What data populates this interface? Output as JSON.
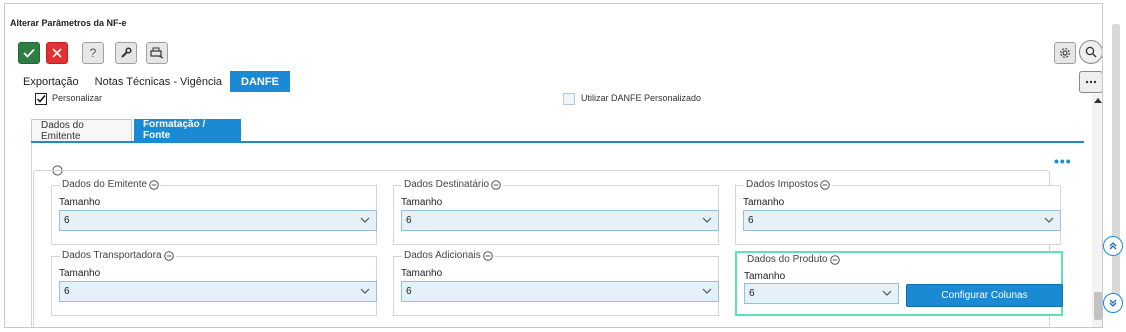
{
  "window": {
    "title": "Alterar Parâmetros da NF-e"
  },
  "toolbar": {
    "confirm_icon": "check-icon",
    "cancel_icon": "close-icon",
    "help_label": "?",
    "tools_icon": "wrench-icon",
    "print_icon": "printer-icon"
  },
  "tabs": [
    {
      "label": "Exportação",
      "active": false
    },
    {
      "label": "Notas Técnicas - Vigência",
      "active": false
    },
    {
      "label": "DANFE",
      "active": true
    }
  ],
  "options": {
    "personalizar": {
      "label": "Personalizar",
      "checked": true
    },
    "danfe_personalizado": {
      "label": "Utilizar DANFE Personalizado",
      "checked": false
    }
  },
  "subtabs": [
    {
      "label": "Dados do Emitente",
      "active": false
    },
    {
      "label": "Formatação / Fonte",
      "active": true
    }
  ],
  "groups": [
    {
      "title": "Dados do Emitente",
      "field_label": "Tamanho",
      "value": "6"
    },
    {
      "title": "Dados Destinatário",
      "field_label": "Tamanho",
      "value": "6"
    },
    {
      "title": "Dados Impostos",
      "field_label": "Tamanho",
      "value": "6"
    },
    {
      "title": "Dados Transportadora",
      "field_label": "Tamanho",
      "value": "6"
    },
    {
      "title": "Dados Adicionais",
      "field_label": "Tamanho",
      "value": "6"
    },
    {
      "title": "Dados do Produto",
      "field_label": "Tamanho",
      "value": "6",
      "button_label": "Configurar Colunas"
    }
  ],
  "colors": {
    "accent": "#1a8ad4",
    "confirm": "#2e7d43",
    "cancel": "#e33131",
    "highlight": "#5ee0b8"
  }
}
